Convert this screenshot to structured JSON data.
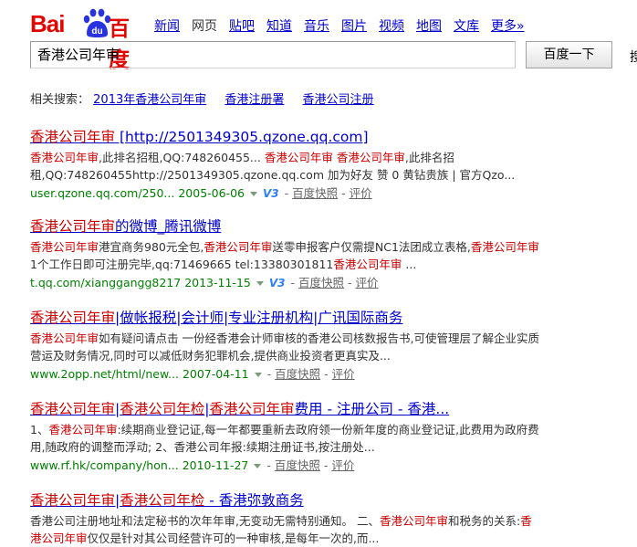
{
  "logo": {
    "part1": "Bai",
    "paw_text": "du",
    "part2": "百度"
  },
  "nav": {
    "items": [
      "新闻",
      "网页",
      "贴吧",
      "知道",
      "音乐",
      "图片",
      "视频",
      "地图",
      "文库",
      "更多»"
    ],
    "current": 1
  },
  "search": {
    "value": "香港公司年审",
    "button_label": "百度一下",
    "edge_char": "搜"
  },
  "related": {
    "label": "相关搜索：",
    "links": [
      "2013年香港公司年审",
      "香港注册署",
      "香港公司注册"
    ]
  },
  "results": [
    {
      "title": [
        {
          "t": "香港公司年审",
          "hl": true
        },
        {
          "t": " [http://2501349305.qzone.qq.com]",
          "hl": false
        }
      ],
      "abstract": [
        {
          "t": "香港公司年审",
          "hl": true
        },
        {
          "t": ",此排名招租,QQ:748260455... ",
          "hl": false
        },
        {
          "t": "香港公司年审",
          "hl": true
        },
        {
          "t": " ",
          "hl": false
        },
        {
          "t": "香港公司年审",
          "hl": true
        },
        {
          "t": ",此排名招租,QQ:748260455http://2501349305.qzone.qq.com 加为好友 赞 0 黄钻贵族 | 官方Qzo...",
          "hl": false
        }
      ],
      "url": "user.qzone.qq.com/250...",
      "date": "2005-06-06",
      "v3": "V3",
      "snapshot": "百度快照",
      "rate": "评价"
    },
    {
      "title": [
        {
          "t": "香港公司年审",
          "hl": true
        },
        {
          "t": "的微博_腾讯微博",
          "hl": false
        }
      ],
      "abstract": [
        {
          "t": "香港公司年审",
          "hl": true
        },
        {
          "t": "港宜商务980元全包,",
          "hl": false
        },
        {
          "t": "香港公司年审",
          "hl": true
        },
        {
          "t": "送零申报客户仅需提NC1法团成立表格,",
          "hl": false
        },
        {
          "t": "香港公司年审",
          "hl": true
        },
        {
          "t": "1个工作日即可注册完毕,qq:71469665 tel:13380301811",
          "hl": false
        },
        {
          "t": "香港公司年审",
          "hl": true
        },
        {
          "t": " ...",
          "hl": false
        }
      ],
      "url": "t.qq.com/xianggangg8217",
      "date": "2013-11-15",
      "v3": "V3",
      "snapshot": "百度快照",
      "rate": "评价"
    },
    {
      "title": [
        {
          "t": "香港公司年审",
          "hl": true
        },
        {
          "t": "|做帐报税|会计师|专业注册机构|广讯国际商务",
          "hl": false
        }
      ],
      "abstract": [
        {
          "t": "香港公司年审",
          "hl": true
        },
        {
          "t": "如有疑问请点击 一份经香港会计师审核的香港公司核数报告书,可使管理层了解企业实质营运及财务情况,同时可以减低财务犯罪机会,提供商业投资者更真实及...",
          "hl": false
        }
      ],
      "url": "www.2opp.net/html/new...",
      "date": "2007-04-11",
      "v3": "",
      "snapshot": "百度快照",
      "rate": "评价"
    },
    {
      "title": [
        {
          "t": "香港公司年审",
          "hl": true
        },
        {
          "t": "|",
          "hl": false
        },
        {
          "t": "香港公司年检",
          "hl": true
        },
        {
          "t": "|",
          "hl": false
        },
        {
          "t": "香港公司年审",
          "hl": true
        },
        {
          "t": "费用 - 注册公司 - 香港...",
          "hl": false
        }
      ],
      "abstract": [
        {
          "t": "1、",
          "hl": false
        },
        {
          "t": "香港公司年审",
          "hl": true
        },
        {
          "t": ":续期商业登记证,每一年都要重新去政府领一份新年度的商业登记证,此费用为政府费用,随政府的调整而浮动; 2、香港公司年报:续期注册证书,按注册处...",
          "hl": false
        }
      ],
      "url": "www.rf.hk/company/hon...",
      "date": "2010-11-27",
      "v3": "",
      "snapshot": "百度快照",
      "rate": "评价"
    },
    {
      "title": [
        {
          "t": "香港公司年审",
          "hl": true
        },
        {
          "t": "|",
          "hl": false
        },
        {
          "t": "香港公司年检",
          "hl": true
        },
        {
          "t": " - 香港弥敦商务",
          "hl": false
        }
      ],
      "abstract": [
        {
          "t": "香港公司注册地址和法定秘书的次年年审,无变动无需特别通知。 二、",
          "hl": false
        },
        {
          "t": "香港公司年审",
          "hl": true
        },
        {
          "t": "和税务的关系:",
          "hl": false
        },
        {
          "t": "香港公司年审",
          "hl": true
        },
        {
          "t": "仅仅是针对其公司经营许可的一种审核,是每年一次的,而...",
          "hl": false
        }
      ],
      "url": "",
      "date": "",
      "v3": "",
      "snapshot": "",
      "rate": ""
    }
  ]
}
